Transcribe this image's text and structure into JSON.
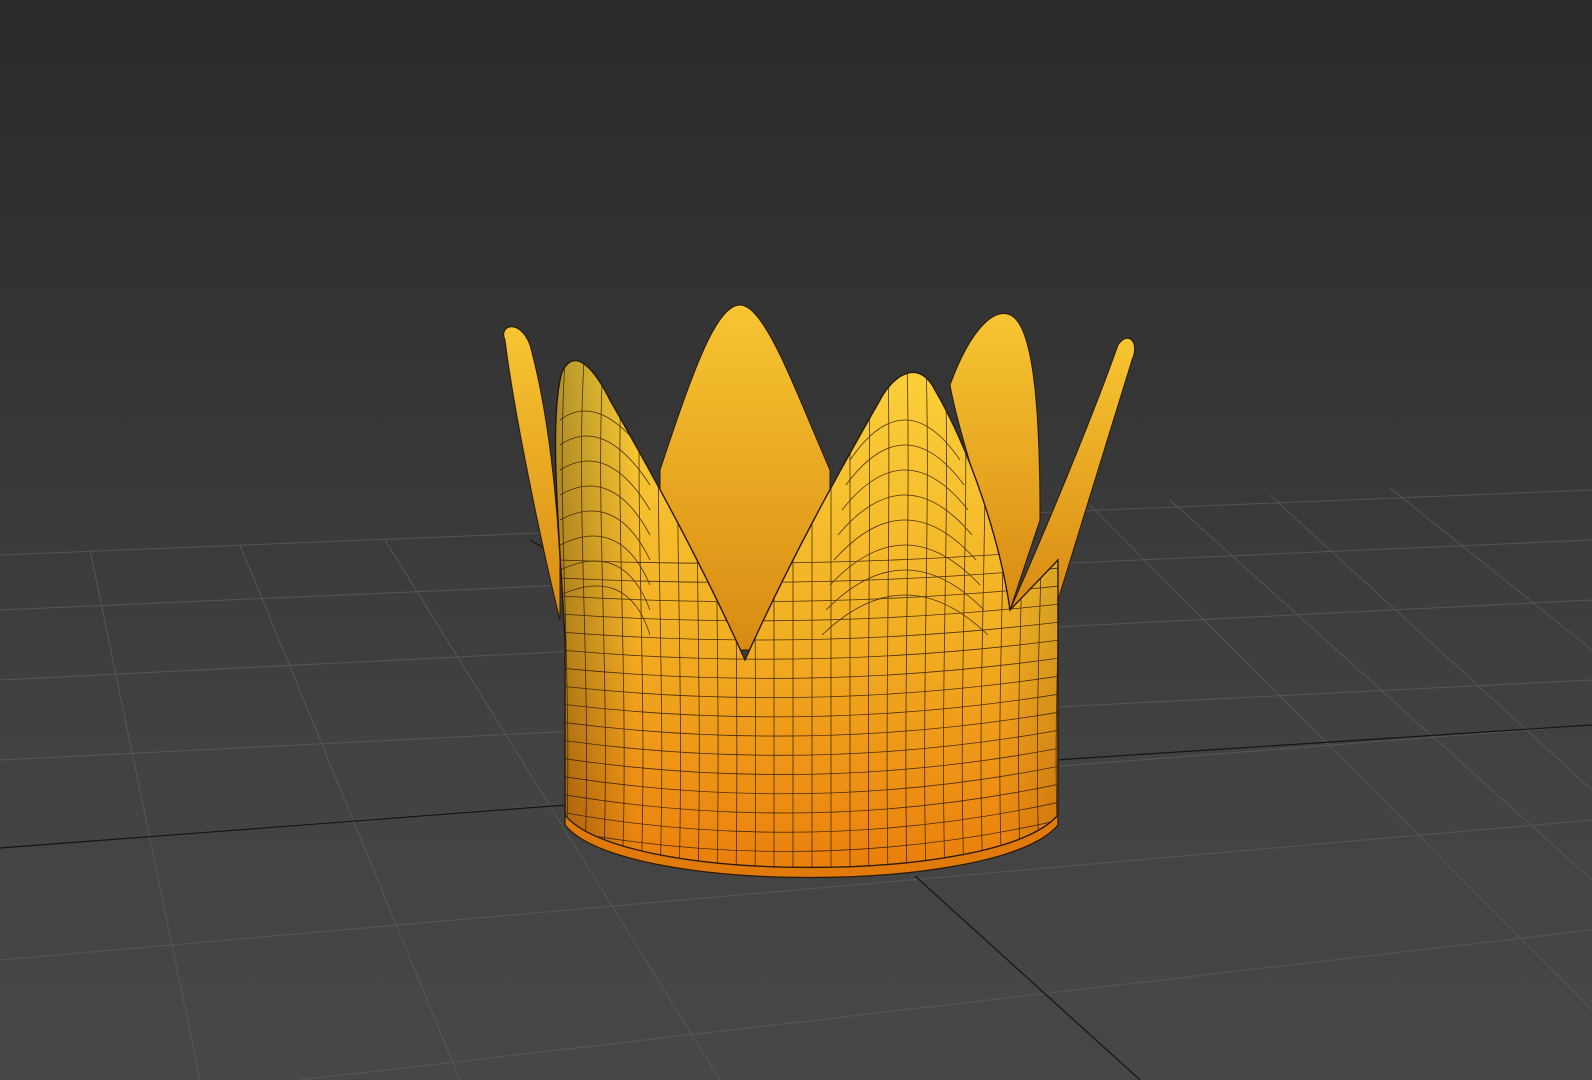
{
  "viewport": {
    "label": "",
    "background_top": "#2b2b2b",
    "background_bottom": "#474747",
    "grid_color": "#5a5a5a",
    "axis_color": "#111111"
  },
  "model": {
    "name": "crown",
    "color_light": "#fbd13a",
    "color_mid": "#f2ae22",
    "color_dark": "#ea7f0c",
    "wire_color": "#2a1a06",
    "points": 6
  }
}
